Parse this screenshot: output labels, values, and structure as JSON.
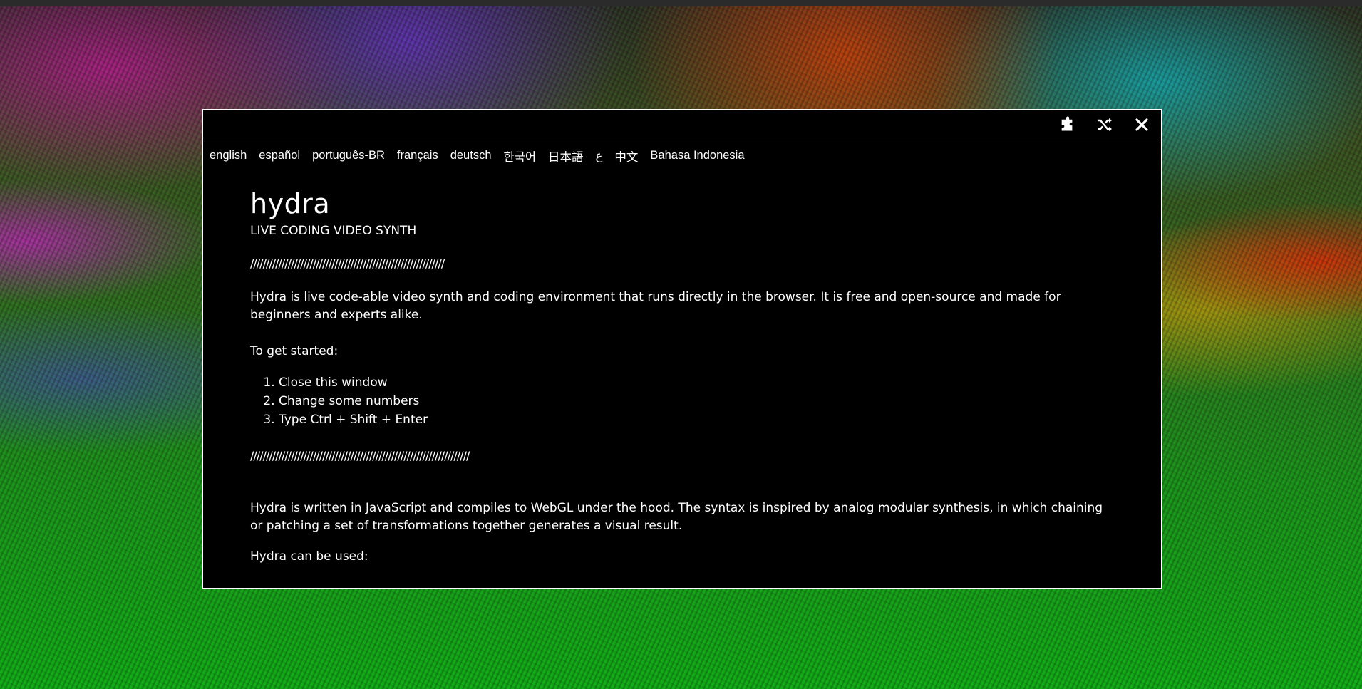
{
  "app": {
    "name": "hydra"
  },
  "window": {
    "header_icons": [
      {
        "icon": "puzzle-icon"
      },
      {
        "icon": "shuffle-icon"
      },
      {
        "icon": "close-icon"
      }
    ]
  },
  "languages": [
    "english",
    "español",
    "português-BR",
    "français",
    "deutsch",
    "한국어",
    "日本語",
    "ع",
    "中文",
    "Bahasa Indonesia"
  ],
  "content": {
    "title": "hydra",
    "subtitle": "LIVE CODING VIDEO SYNTH",
    "divider1": "//////////////////////////////////////////////////////////////",
    "intro": "Hydra is live code-able video synth and coding environment that runs directly in the browser. It is free and open-source and made for beginners and experts alike.",
    "getting_started": "To get started:",
    "steps": [
      "Close this window",
      "Change some numbers",
      "Type Ctrl + Shift + Enter"
    ],
    "divider2": "//////////////////////////////////////////////////////////////////////",
    "description": "Hydra is written in JavaScript and compiles to WebGL under the hood. The syntax is inspired by analog modular synthesis, in which chaining or patching a set of transformations together generates a visual result.",
    "can_be_used": "Hydra can be used:"
  },
  "colors": {
    "window_bg": "#000000",
    "window_border": "#ffffff",
    "text": "#ffffff"
  }
}
